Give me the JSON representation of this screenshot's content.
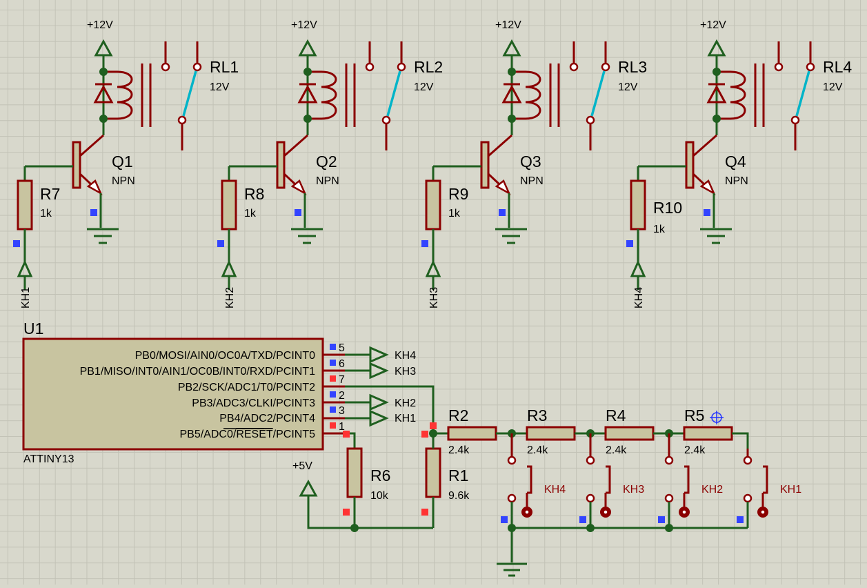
{
  "relay_stages": [
    {
      "supply": "+12V",
      "relay": "RL1",
      "relay_value": "12V",
      "transistor": "Q1",
      "transistor_type": "NPN",
      "resistor": "R7",
      "resistor_value": "1k",
      "input": "KH1"
    },
    {
      "supply": "+12V",
      "relay": "RL2",
      "relay_value": "12V",
      "transistor": "Q2",
      "transistor_type": "NPN",
      "resistor": "R8",
      "resistor_value": "1k",
      "input": "KH2"
    },
    {
      "supply": "+12V",
      "relay": "RL3",
      "relay_value": "12V",
      "transistor": "Q3",
      "transistor_type": "NPN",
      "resistor": "R9",
      "resistor_value": "1k",
      "input": "KH3"
    },
    {
      "supply": "+12V",
      "relay": "RL4",
      "relay_value": "12V",
      "transistor": "Q4",
      "transistor_type": "NPN",
      "resistor": "R10",
      "resistor_value": "1k",
      "input": "KH4"
    }
  ],
  "mcu": {
    "ref": "U1",
    "part": "ATTINY13",
    "pins": [
      {
        "name": "PB0/MOSI/AIN0/OC0A/TXD/PCINT0",
        "num": "5",
        "net": "KH4"
      },
      {
        "name": "PB1/MISO/INT0/AIN1/OC0B/INT0/RXD/PCINT1",
        "num": "6",
        "net": "KH3"
      },
      {
        "name": "PB2/SCK/ADC1/T0/PCINT2",
        "num": "7",
        "net": ""
      },
      {
        "name": "PB3/ADC3/CLKI/PCINT3",
        "num": "2",
        "net": "KH2"
      },
      {
        "name": "PB4/ADC2/PCINT4",
        "num": "3",
        "net": "KH1"
      },
      {
        "name_pre": "PB5/ADC0/",
        "name_over": "RESET",
        "name_post": "/PCINT5",
        "num": "1",
        "net": ""
      }
    ]
  },
  "resistors": [
    {
      "ref": "R6",
      "value": "10k"
    },
    {
      "ref": "R1",
      "value": "9.6k"
    },
    {
      "ref": "R2",
      "value": "2.4k"
    },
    {
      "ref": "R3",
      "value": "2.4k"
    },
    {
      "ref": "R4",
      "value": "2.4k"
    },
    {
      "ref": "R5",
      "value": "2.4k"
    }
  ],
  "buttons": [
    "KH4",
    "KH3",
    "KH2",
    "KH1"
  ],
  "power_5v": "+5V"
}
